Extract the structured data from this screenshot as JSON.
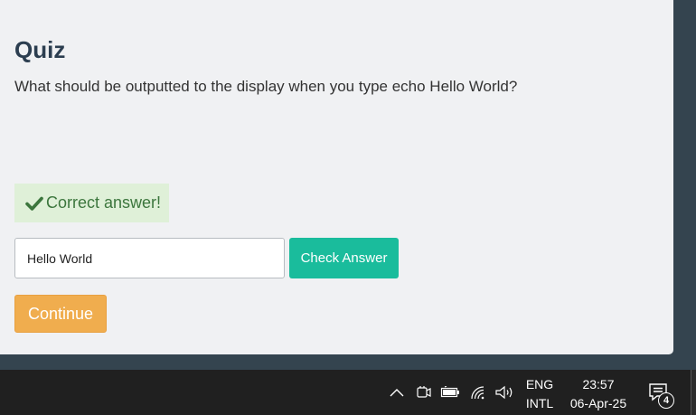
{
  "quiz": {
    "title": "Quiz",
    "question": "What should be outputted to the display when you type echo Hello World?",
    "feedback": "Correct answer!",
    "answer_value": "Hello World",
    "check_label": "Check Answer",
    "continue_label": "Continue"
  },
  "taskbar": {
    "lang_top": "ENG",
    "lang_bottom": "INTL",
    "time": "23:57",
    "date": "06-Apr-25",
    "notification_count": "4",
    "icons": [
      "chevron-up-icon",
      "meet-now-icon",
      "battery-icon",
      "wifi-icon",
      "volume-icon",
      "notification-icon"
    ]
  },
  "colors": {
    "page_bg": "#34444f",
    "card_bg": "#f0f1f3",
    "title": "#2c3e50",
    "success_bg": "#dff0d8",
    "success_text": "#3c763d",
    "check_button": "#1abc9c",
    "continue_button": "#f0ad4e",
    "taskbar": "#202020"
  }
}
